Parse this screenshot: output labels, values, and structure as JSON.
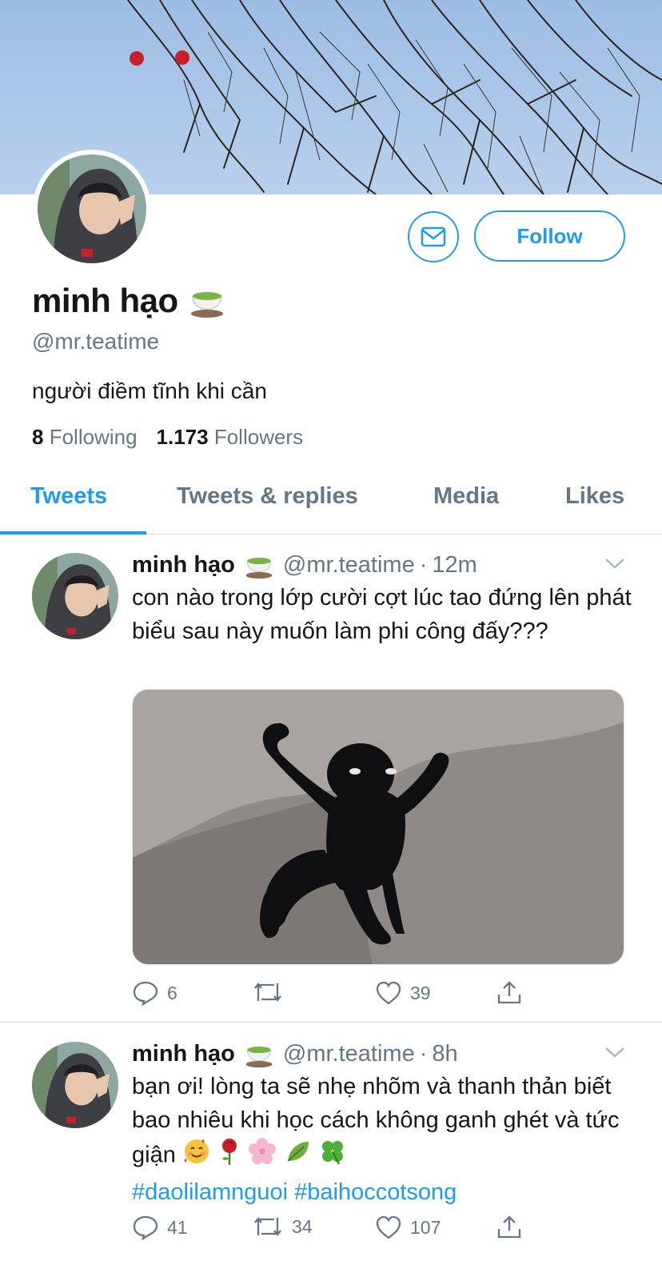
{
  "profile": {
    "name": "minh hạo",
    "handle": "@mr.teatime",
    "bio": "người điềm tĩnh khi cần",
    "following_count": "8",
    "following_label": "Following",
    "followers_count": "1.173",
    "followers_label": "Followers",
    "follow_label": "Follow",
    "name_emoji": "tea-cup-icon"
  },
  "tabs": [
    {
      "label": "Tweets",
      "active": true
    },
    {
      "label": "Tweets & replies",
      "active": false
    },
    {
      "label": "Media",
      "active": false
    },
    {
      "label": "Likes",
      "active": false
    }
  ],
  "tweets": [
    {
      "name": "minh hạo",
      "handle": "@mr.teatime",
      "sep": "·",
      "time": "12m",
      "text": "con nào trong lớp cười cợt lúc tao đứng lên phát biểu sau này muốn làm phi công đấy???",
      "media": "black-cat-meme-image",
      "replies": "6",
      "retweets": "",
      "likes": "39"
    },
    {
      "name": "minh hạo",
      "handle": "@mr.teatime",
      "sep": "·",
      "time": "8h",
      "text": "bạn ơi! lòng ta sẽ nhẹ nhõm và thanh thản biết bao nhiêu khi học cách không ganh ghét và tức giận",
      "emojis": [
        "smiling-face-with-hearts-icon",
        "rose-icon",
        "cherry-blossom-icon",
        "leaf-icon",
        "four-leaf-clover-icon"
      ],
      "hashtags": [
        "#daolilamnguoi",
        "#baihoccotsong"
      ],
      "replies": "41",
      "retweets": "34",
      "likes": "107"
    }
  ],
  "colors": {
    "accent": "#1d9bf0",
    "secondary_text": "#657786",
    "divider": "#d6dbe0"
  }
}
